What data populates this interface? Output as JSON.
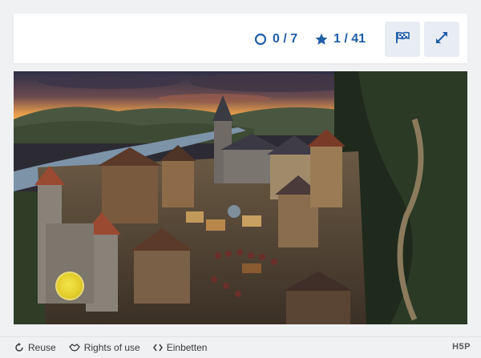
{
  "stats": {
    "found": "0 / 7",
    "stars": "1 / 41"
  },
  "toolbar": {
    "flag_icon": "flag-icon",
    "expand_icon": "expand-icon"
  },
  "scene": {
    "image": "medieval town illustration",
    "hotspot_color": "#e6d12f"
  },
  "footer": {
    "reuse_label": "Reuse",
    "rights_label": "Rights of use",
    "embed_label": "Einbetten",
    "brand": "H5P"
  },
  "colors": {
    "accent": "#1f5ea8",
    "button_bg": "#e8edf3",
    "page_bg": "#f0f1f3"
  }
}
